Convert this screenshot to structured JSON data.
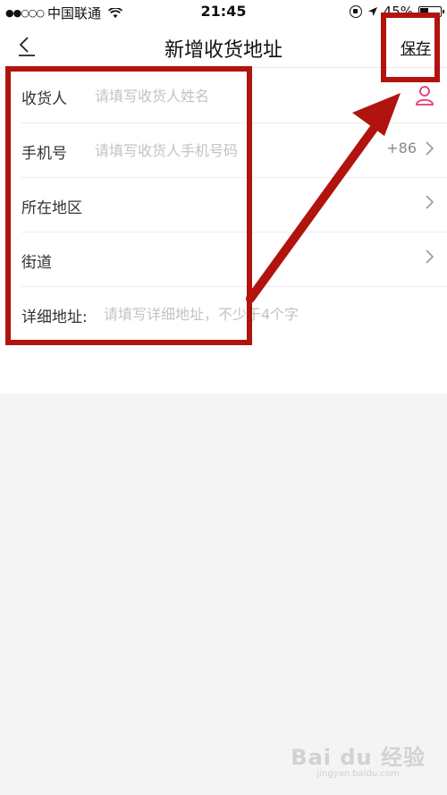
{
  "status_bar": {
    "signal": "●●○○○",
    "carrier": "中国联通",
    "time": "21:45",
    "battery_text": "45%",
    "battery_level": 0.45
  },
  "nav": {
    "title": "新增收货地址",
    "save_label": "保存"
  },
  "form": {
    "rows": [
      {
        "label": "收货人",
        "placeholder": "请填写收货人姓名"
      },
      {
        "label": "手机号",
        "placeholder": "请填写收货人手机号码",
        "prefix": "+86"
      },
      {
        "label": "所在地区"
      },
      {
        "label": "街道"
      },
      {
        "label": "详细地址:",
        "placeholder": "请填写详细地址，不少于4个字"
      }
    ]
  },
  "colors": {
    "annotation_red": "#b1130e",
    "accent_pink": "#e23a6e"
  },
  "watermark": {
    "logo": "Bai du 经验",
    "url": "jingyan.baidu.com"
  }
}
